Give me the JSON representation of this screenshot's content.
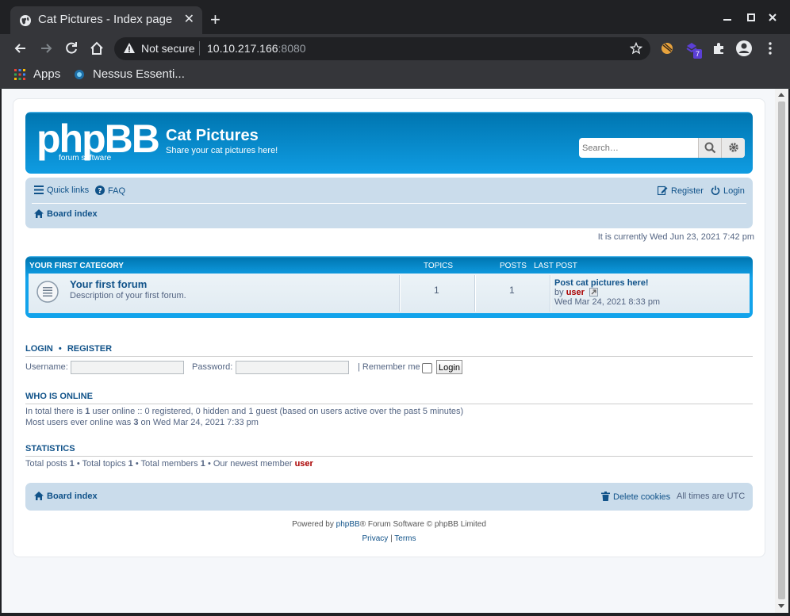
{
  "browser": {
    "tab_title": "Cat Pictures - Index page",
    "address_security": "Not secure",
    "address_host": "10.10.217.166",
    "address_port": ":8080",
    "extension_badge": "7",
    "bookmarks": [
      {
        "label": "Apps",
        "icon": "apps-grid-icon"
      },
      {
        "label": "Nessus Essenti...",
        "icon": "nessus-icon"
      }
    ]
  },
  "header": {
    "logo_text": "phpBB",
    "logo_subtext": "forum software",
    "site_title": "Cat Pictures",
    "site_description": "Share your cat pictures here!",
    "search_placeholder": "Search…",
    "accent_color": "#12a3eb"
  },
  "navbar": {
    "quick_links": "Quick links",
    "faq": "FAQ",
    "register": "Register",
    "login": "Login",
    "breadcrumb": "Board index"
  },
  "time_info": "It is currently Wed Jun 23, 2021 7:42 pm",
  "forum_table": {
    "headers": {
      "category": "YOUR FIRST CATEGORY",
      "topics": "TOPICS",
      "posts": "POSTS",
      "last_post": "LAST POST"
    },
    "rows": [
      {
        "title": "Your first forum",
        "description": "Description of your first forum.",
        "topics": "1",
        "posts": "1",
        "last_post_title": "Post cat pictures here!",
        "last_post_by_prefix": "by",
        "last_post_user": "user",
        "last_post_date": "Wed Mar 24, 2021 8:33 pm"
      }
    ]
  },
  "login_section": {
    "heading_login": "LOGIN",
    "heading_sep": "•",
    "heading_register": "REGISTER",
    "username_label": "Username:",
    "password_label": "Password:",
    "remember_label": "| Remember me",
    "login_button": "Login"
  },
  "who_is_online": {
    "heading": "WHO IS ONLINE",
    "line1_prefix": "In total there is",
    "line1_count": "1",
    "line1_suffix": "user online :: 0 registered, 0 hidden and 1 guest (based on users active over the past 5 minutes)",
    "line2_prefix": "Most users ever online was",
    "line2_count": "3",
    "line2_suffix": "on Wed Mar 24, 2021 7:33 pm"
  },
  "statistics": {
    "heading": "STATISTICS",
    "total_posts_label": "Total posts",
    "total_posts": "1",
    "total_topics_label": "• Total topics",
    "total_topics": "1",
    "total_members_label": "• Total members",
    "total_members": "1",
    "newest_label": "• Our newest member",
    "newest_member": "user"
  },
  "footer": {
    "board_index": "Board index",
    "delete_cookies": "Delete cookies",
    "timezone": "All times are UTC",
    "powered_prefix": "Powered by",
    "powered_link": "phpBB",
    "powered_suffix": "® Forum Software © phpBB Limited",
    "privacy": "Privacy",
    "sep": "|",
    "terms": "Terms"
  }
}
